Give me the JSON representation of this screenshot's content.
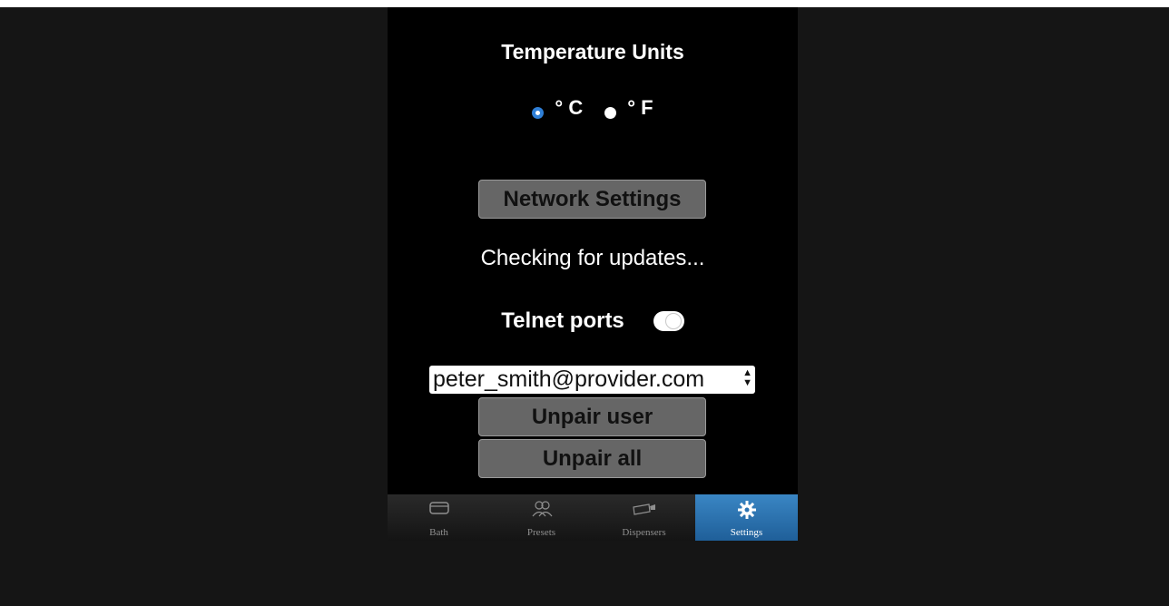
{
  "settings": {
    "temperature_title": "Temperature Units",
    "units": [
      {
        "label": "° C",
        "selected": true
      },
      {
        "label": "° F",
        "selected": false
      }
    ],
    "network_button": "Network Settings",
    "update_status": "Checking for updates...",
    "telnet_label": "Telnet ports",
    "telnet_enabled": false,
    "user_select_value": "peter_smith@provider.com",
    "unpair_user_button": "Unpair user",
    "unpair_all_button": "Unpair all"
  },
  "tabs": [
    {
      "label": "Bath",
      "icon": "bath-icon",
      "active": false
    },
    {
      "label": "Presets",
      "icon": "presets-icon",
      "active": false
    },
    {
      "label": "Dispensers",
      "icon": "dispensers-icon",
      "active": false
    },
    {
      "label": "Settings",
      "icon": "gear-icon",
      "active": true
    }
  ],
  "colors": {
    "accent": "#2f7fd6",
    "active_tab": "#2c74b3"
  }
}
